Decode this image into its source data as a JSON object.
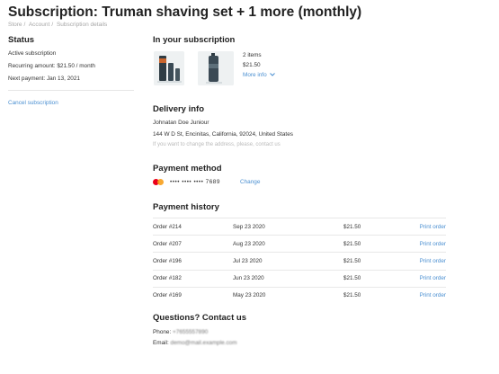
{
  "header": {
    "title": "Subscription: Truman shaving set + 1 more (monthly)",
    "breadcrumb": [
      "Store",
      "Account",
      "Subscription details"
    ]
  },
  "status": {
    "heading": "Status",
    "state": "Active subscription",
    "recurring": "Recurring amount: $21.50 / month",
    "next_payment": "Next payment: Jan 13, 2021",
    "cancel_label": "Cancel subscription"
  },
  "subscription": {
    "heading": "In your subscription",
    "items_count": "2 items",
    "price": "$21.50",
    "more_info": "More info",
    "more_info_icon": "chevron-down-icon"
  },
  "delivery": {
    "heading": "Delivery info",
    "name": "Johnatan Doe Juniour",
    "address": "144 W D St, Encinitas, California, 92024, United States",
    "note": "If you want to change the address, please, contact us"
  },
  "payment_method": {
    "heading": "Payment method",
    "card_brand_icon": "mastercard-icon",
    "masked": "•••• •••• •••• 7689",
    "change_label": "Change",
    "colors": {
      "red": "#eb001b",
      "orange": "#f79e1b"
    }
  },
  "history": {
    "heading": "Payment history",
    "rows": [
      {
        "order": "Order #214",
        "date": "Sep 23 2020",
        "amount": "$21.50",
        "action": "Print order"
      },
      {
        "order": "Order #207",
        "date": "Aug 23 2020",
        "amount": "$21.50",
        "action": "Print order"
      },
      {
        "order": "Order #196",
        "date": "Jul 23 2020",
        "amount": "$21.50",
        "action": "Print order"
      },
      {
        "order": "Order #182",
        "date": "Jun 23 2020",
        "amount": "$21.50",
        "action": "Print order"
      },
      {
        "order": "Order #169",
        "date": "May 23 2020",
        "amount": "$21.50",
        "action": "Print order"
      }
    ]
  },
  "contact": {
    "heading": "Questions? Contact us",
    "phone_label": "Phone:",
    "phone_value": "+7655557890",
    "email_label": "Email:",
    "email_value": "demo@mail.example.com"
  },
  "colors": {
    "link": "#4a8fd1",
    "text": "#333333",
    "muted": "#bbbbbb"
  }
}
